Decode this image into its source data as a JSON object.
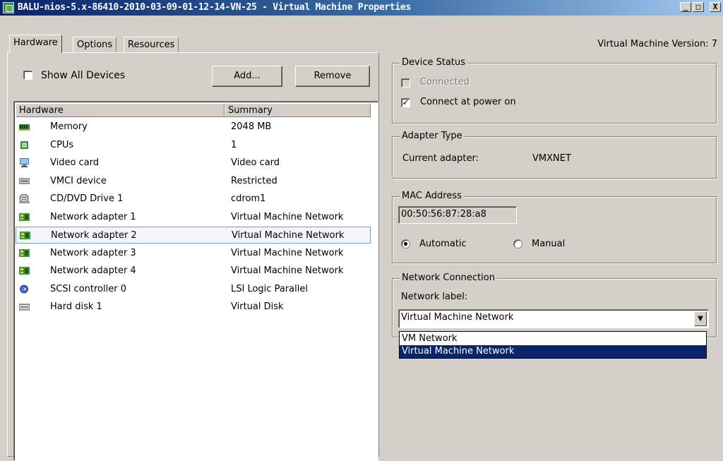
{
  "window": {
    "title": "BALU-nios-5.x-86410-2010-03-09-01-12-14-VN-25 - Virtual Machine Properties",
    "minimize": "_",
    "restore": "□",
    "close": "X"
  },
  "tabs": [
    {
      "label": "Hardware",
      "active": true
    },
    {
      "label": "Options",
      "active": false
    },
    {
      "label": "Resources",
      "active": false
    }
  ],
  "vm_version": "Virtual Machine Version: 7",
  "hardware_panel": {
    "show_all_devices_label": "Show All Devices",
    "show_all_devices_checked": false,
    "add_button": "Add...",
    "remove_button": "Remove",
    "columns": [
      "Hardware",
      "Summary"
    ],
    "rows": [
      {
        "name": "Memory",
        "summary": "2048 MB",
        "icon": "memory-icon"
      },
      {
        "name": "CPUs",
        "summary": "1",
        "icon": "cpu-icon"
      },
      {
        "name": "Video card",
        "summary": "Video card",
        "icon": "monitor-icon"
      },
      {
        "name": "VMCI device",
        "summary": "Restricted",
        "icon": "vmci-device-icon"
      },
      {
        "name": "CD/DVD Drive 1",
        "summary": "cdrom1",
        "icon": "cd-drive-icon"
      },
      {
        "name": "Network adapter 1",
        "summary": "Virtual Machine Network",
        "icon": "network-adapter-icon"
      },
      {
        "name": "Network adapter 2",
        "summary": "Virtual Machine Network",
        "icon": "network-adapter-icon",
        "selected": true
      },
      {
        "name": "Network adapter 3",
        "summary": "Virtual Machine Network",
        "icon": "network-adapter-icon"
      },
      {
        "name": "Network adapter 4",
        "summary": "Virtual Machine Network",
        "icon": "network-adapter-icon"
      },
      {
        "name": "SCSI controller 0",
        "summary": "LSI Logic Parallel",
        "icon": "scsi-controller-icon"
      },
      {
        "name": "Hard disk 1",
        "summary": "Virtual Disk",
        "icon": "hard-disk-icon"
      }
    ]
  },
  "device_status": {
    "title": "Device Status",
    "connected_label": "Connected",
    "connected_checked": false,
    "connect_at_power_on_label": "Connect at power on",
    "connect_at_power_on_checked": true
  },
  "adapter_type": {
    "title": "Adapter Type",
    "current_label": "Current adapter:",
    "current_value": "VMXNET"
  },
  "mac_address": {
    "title": "MAC Address",
    "value": "00:50:56:87:28:a8",
    "automatic_label": "Automatic",
    "manual_label": "Manual",
    "selected": "automatic"
  },
  "network_connection": {
    "title": "Network Connection",
    "label": "Network label:",
    "selected_value": "Virtual Machine Network",
    "options": [
      "VM Network",
      "Virtual Machine Network"
    ]
  },
  "colors": {
    "window_bg": "#d4d0c8",
    "title_start": "#0a246a",
    "title_end": "#a6caf0",
    "selection": "#0a246a",
    "network_adapter_icon": "#3f9a3a"
  }
}
